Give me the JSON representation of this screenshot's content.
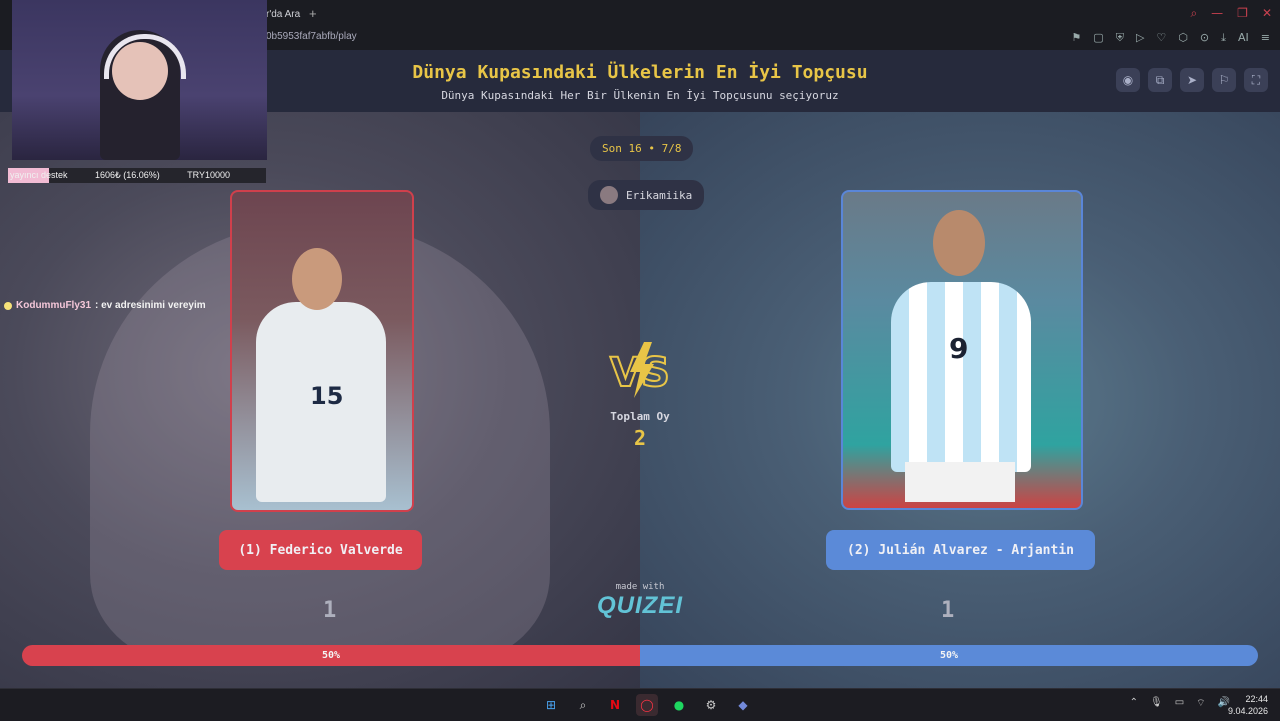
{
  "browser": {
    "tab_title": "r'da Ara",
    "tab_add": "+",
    "url": "0b5953faf7abfb/play",
    "nav_ai": "AI"
  },
  "header": {
    "title": "Dünya Kupasındaki Ülkelerin En İyi Topçusu",
    "subtitle": "Dünya Kupasındaki Her Bir Ülkenin En İyi Topçusunu seçiyoruz"
  },
  "round": "Son 16 • 7/8",
  "creator": "Erikamiika",
  "total_votes": {
    "label": "Toplam Oy",
    "value": "2"
  },
  "left_choice": {
    "label": "(1) Federico Valverde",
    "jersey_number": "15",
    "votes": "1",
    "percent_label": "50%",
    "share": 0.5,
    "accent": "#d8424e"
  },
  "right_choice": {
    "label": "(2) Julián Alvarez - Arjantin",
    "jersey_number": "9",
    "votes": "1",
    "percent_label": "50%",
    "share": 0.5,
    "accent": "#5b8ad8"
  },
  "branding": {
    "made_with": "made with",
    "logo": "QUIZEI"
  },
  "stream_overlay": {
    "support_label_a": "yayıncı",
    "support_label_b": "destek",
    "support_amount": "1606₺ (16.06%)",
    "support_goal": "TRY10000",
    "support_fraction": 0.1606,
    "chat_user": "KodummuFly31",
    "chat_text": ": ev adresinimi vereyim"
  },
  "taskbar": {
    "time": "22:44",
    "date": "9.04.2026"
  },
  "colors": {
    "title_gold": "#e8c547",
    "red": "#d8424e",
    "blue": "#5b8ad8"
  }
}
